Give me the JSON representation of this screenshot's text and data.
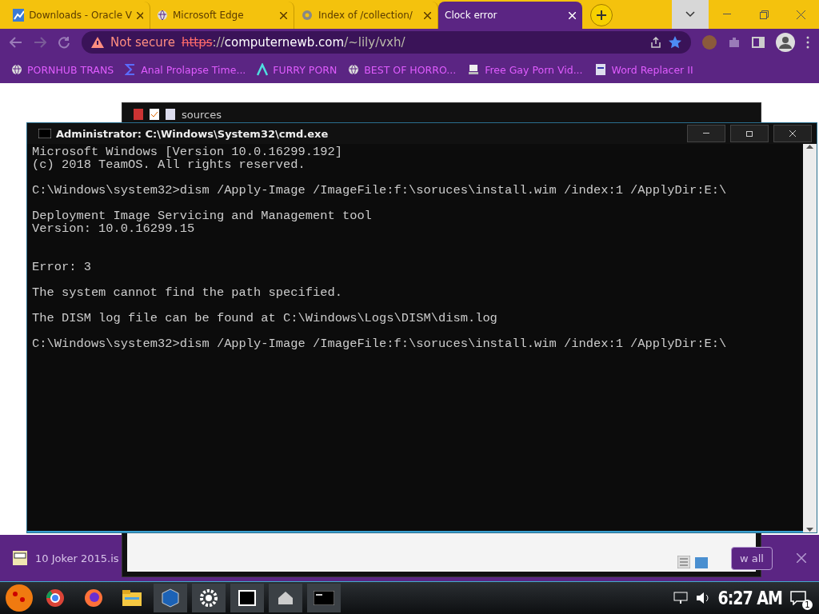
{
  "browser": {
    "tabs": [
      {
        "title": "Downloads - Oracle V",
        "selected": false
      },
      {
        "title": "Microsoft Edge",
        "selected": false
      },
      {
        "title": "Index of /collection/",
        "selected": false
      },
      {
        "title": "Clock error",
        "selected": true
      }
    ],
    "address": {
      "security": "Not secure",
      "scheme": "https",
      "rest": "://",
      "host": "computernewb.com",
      "path": "/~lily/vxh/"
    },
    "bookmarks": [
      {
        "label": "PORNHUB TRANS"
      },
      {
        "label": "Anal Prolapse Time..."
      },
      {
        "label": "FURRY PORN"
      },
      {
        "label": "BEST OF HORRO..."
      },
      {
        "label": "Free Gay Porn Vid..."
      },
      {
        "label": "Word Replacer II"
      }
    ],
    "download_bar": {
      "file": "10 Joker 2015.is",
      "button": "w all"
    }
  },
  "explorer": {
    "location": "sources"
  },
  "cmd": {
    "title": "Administrator: C:\\Windows\\System32\\cmd.exe",
    "blocks": [
      {
        "kind": "top",
        "lines": [
          "Microsoft Windows [Version 10.0.16299.192]",
          "(c) 2018 TeamOS. All rights reserved."
        ]
      },
      {
        "kind": "para",
        "lines": [
          "C:\\Windows\\system32>dism /Apply-Image /ImageFile:f:\\soruces\\install.wim /index:1 /ApplyDir:E:\\"
        ]
      },
      {
        "kind": "para",
        "lines": [
          "Deployment Image Servicing and Management tool",
          "Version: 10.0.16299.15"
        ]
      },
      {
        "kind": "wide",
        "lines": [
          "Error: 3"
        ]
      },
      {
        "kind": "para",
        "lines": [
          "The system cannot find the path specified."
        ]
      },
      {
        "kind": "para",
        "lines": [
          "The DISM log file can be found at C:\\Windows\\Logs\\DISM\\dism.log"
        ]
      },
      {
        "kind": "para",
        "lines": [
          "C:\\Windows\\system32>dism /Apply-Image /ImageFile:f:\\soruces\\install.wim /index:1 /ApplyDir:E:\\"
        ]
      }
    ]
  },
  "taskbar": {
    "clock": "6:27 AM",
    "notifications": "1"
  }
}
